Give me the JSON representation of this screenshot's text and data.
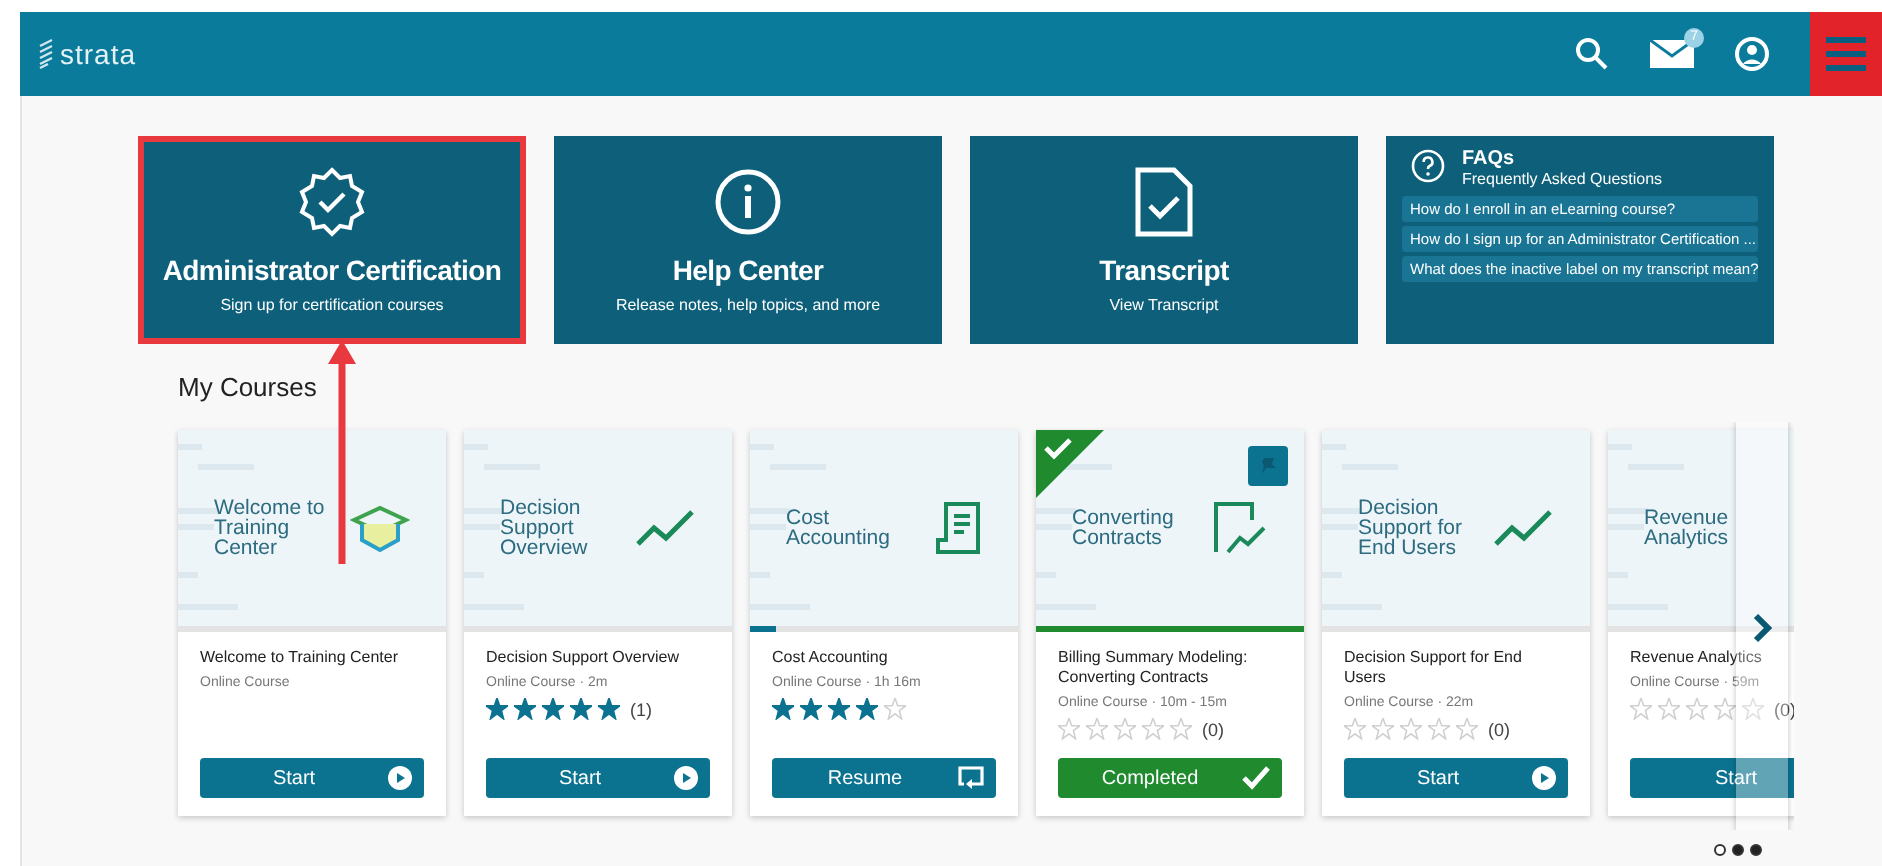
{
  "header": {
    "logo": "strata",
    "mail_badge": "7"
  },
  "tiles": [
    {
      "kind": "badge",
      "title": "Administrator Certification",
      "subtitle": "Sign up for certification courses",
      "highlighted": true
    },
    {
      "kind": "info",
      "title": "Help Center",
      "subtitle": "Release notes, help topics, and more",
      "highlighted": false
    },
    {
      "kind": "document",
      "title": "Transcript",
      "subtitle": "View Transcript",
      "highlighted": false
    }
  ],
  "faqs": {
    "title": "FAQs",
    "subtitle": "Frequently Asked Questions",
    "questions": [
      "How do I enroll in an eLearning course?",
      "How do I sign up for an Administrator Certification ...",
      "What does the inactive label on my transcript mean?"
    ]
  },
  "courses": {
    "heading": "My Courses",
    "items": [
      {
        "cover_title": "Welcome to Training Center",
        "name": "Welcome to Training Center",
        "meta": "Online Course",
        "completed": false,
        "pinned": false,
        "button": {
          "label": "Start",
          "kind": "play"
        }
      },
      {
        "cover_title": "Decision Support Overview",
        "name": "Decision Support Overview",
        "meta": "Online Course · 2m",
        "stars": 5,
        "rating_count": "(1)",
        "completed": false,
        "pinned": false,
        "button": {
          "label": "Start",
          "kind": "play"
        }
      },
      {
        "cover_title": "Cost Accounting",
        "name": "Cost Accounting",
        "meta": "Online Course · 1h 16m",
        "stars": 4,
        "level": 0.1,
        "completed": false,
        "pinned": false,
        "button": {
          "label": "Resume",
          "kind": "resume"
        }
      },
      {
        "cover_title": "Converting Contracts",
        "name": "Billing Summary Modeling: Converting Contracts",
        "meta": "Online Course · 10m - 15m",
        "stars": 0,
        "rating_count": "(0)",
        "level": 1,
        "completed": true,
        "pinned": true,
        "button": {
          "label": "Completed",
          "kind": "done"
        }
      },
      {
        "cover_title": "Decision Support for End Users",
        "name": "Decision Support for End Users",
        "meta": "Online Course · 22m",
        "stars": 0,
        "rating_count": "(0)",
        "completed": false,
        "pinned": false,
        "button": {
          "label": "Start",
          "kind": "play"
        }
      },
      {
        "cover_title": "Revenue Analytics",
        "name": "Revenue Analytics",
        "meta": "Online Course · 59m",
        "stars": 0,
        "rating_count": "(0)",
        "completed": false,
        "pinned": false,
        "button": {
          "label": "Start",
          "kind": "play"
        }
      }
    ]
  },
  "pager": [
    {
      "selected": false
    },
    {
      "selected": true
    },
    {
      "selected": true
    }
  ]
}
